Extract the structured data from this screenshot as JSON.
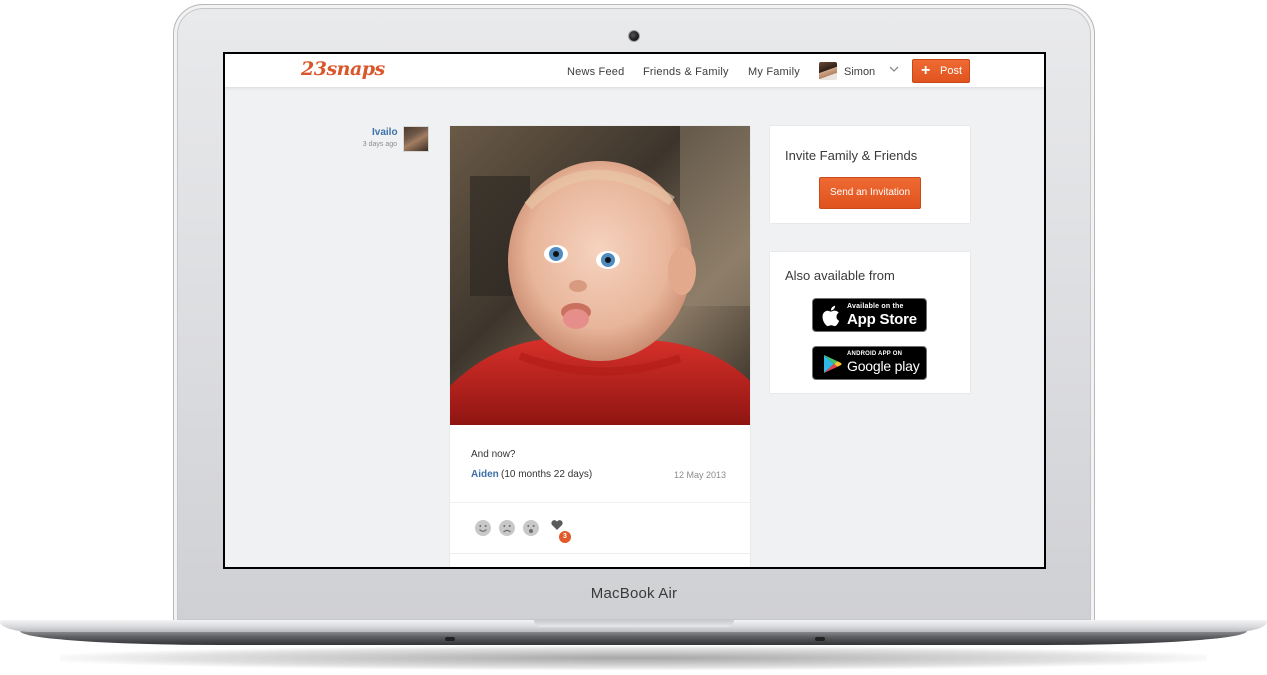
{
  "device": {
    "label": "MacBook Air"
  },
  "header": {
    "logo": "23snaps",
    "nav": {
      "news_feed": "News Feed",
      "friends_family": "Friends & Family",
      "my_family": "My Family"
    },
    "user": {
      "name": "Simon"
    },
    "post_button": "Post",
    "accent_color": "#e35a25"
  },
  "feed": {
    "post": {
      "author": "Ivailo",
      "time_ago": "3 days ago",
      "caption": "And now?",
      "child_name": "Aiden",
      "child_age": "(10 months 22 days)",
      "date": "12 May 2013",
      "heart_count": "3",
      "reactions": [
        "smile-icon",
        "sad-icon",
        "surprised-icon",
        "heart-icon"
      ]
    }
  },
  "sidebar": {
    "invite": {
      "title": "Invite Family & Friends",
      "button": "Send an Invitation"
    },
    "apps": {
      "title": "Also available from",
      "app_store": {
        "small": "Available on the",
        "big": "App Store"
      },
      "google_play": {
        "small": "ANDROID APP ON",
        "big": "Google play"
      }
    }
  }
}
